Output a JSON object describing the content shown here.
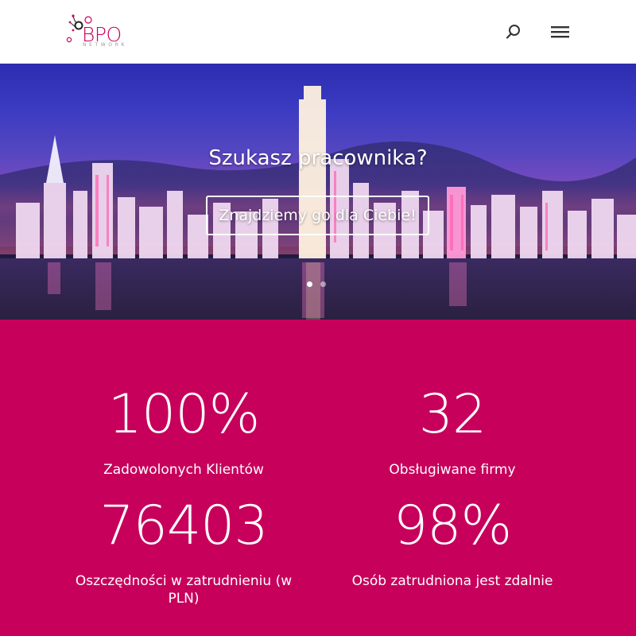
{
  "header": {
    "logo_text": "BPO",
    "logo_subtext": "NETWORK",
    "search_icon": "search-icon",
    "menu_icon": "hamburger-menu-icon"
  },
  "hero": {
    "title": "Szukasz pracownika?",
    "cta_label": "Znajdziemy go dla Ciebie!",
    "slides": {
      "count": 2,
      "active": 1
    }
  },
  "stats": [
    {
      "value": "100%",
      "label": "Zadowolonych Klientów"
    },
    {
      "value": "32",
      "label": "Obsługiwane firmy"
    },
    {
      "value": "76403",
      "label": "Oszczędności w zatrudnieniu (w PLN)"
    },
    {
      "value": "98%",
      "label": "Osób zatrudniona jest zdalnie"
    }
  ],
  "colors": {
    "brand": "#c8005f",
    "stats_background": "#c7005c",
    "text_on_brand": "#ffffff"
  }
}
